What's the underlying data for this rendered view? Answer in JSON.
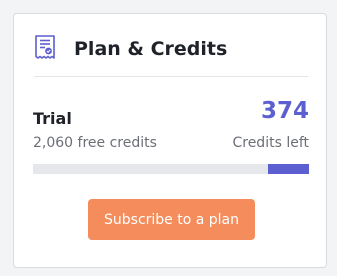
{
  "card": {
    "title": "Plan & Credits",
    "icon": "receipt-icon",
    "accent_color": "#5b5fcf"
  },
  "plan": {
    "name": "Trial",
    "free_credits_text": "2,060 free credits"
  },
  "credits": {
    "remaining": "374",
    "label": "Credits left",
    "fraction_left": 0.15
  },
  "actions": {
    "subscribe_label": "Subscribe to a plan",
    "subscribe_color": "#f48c5c"
  }
}
